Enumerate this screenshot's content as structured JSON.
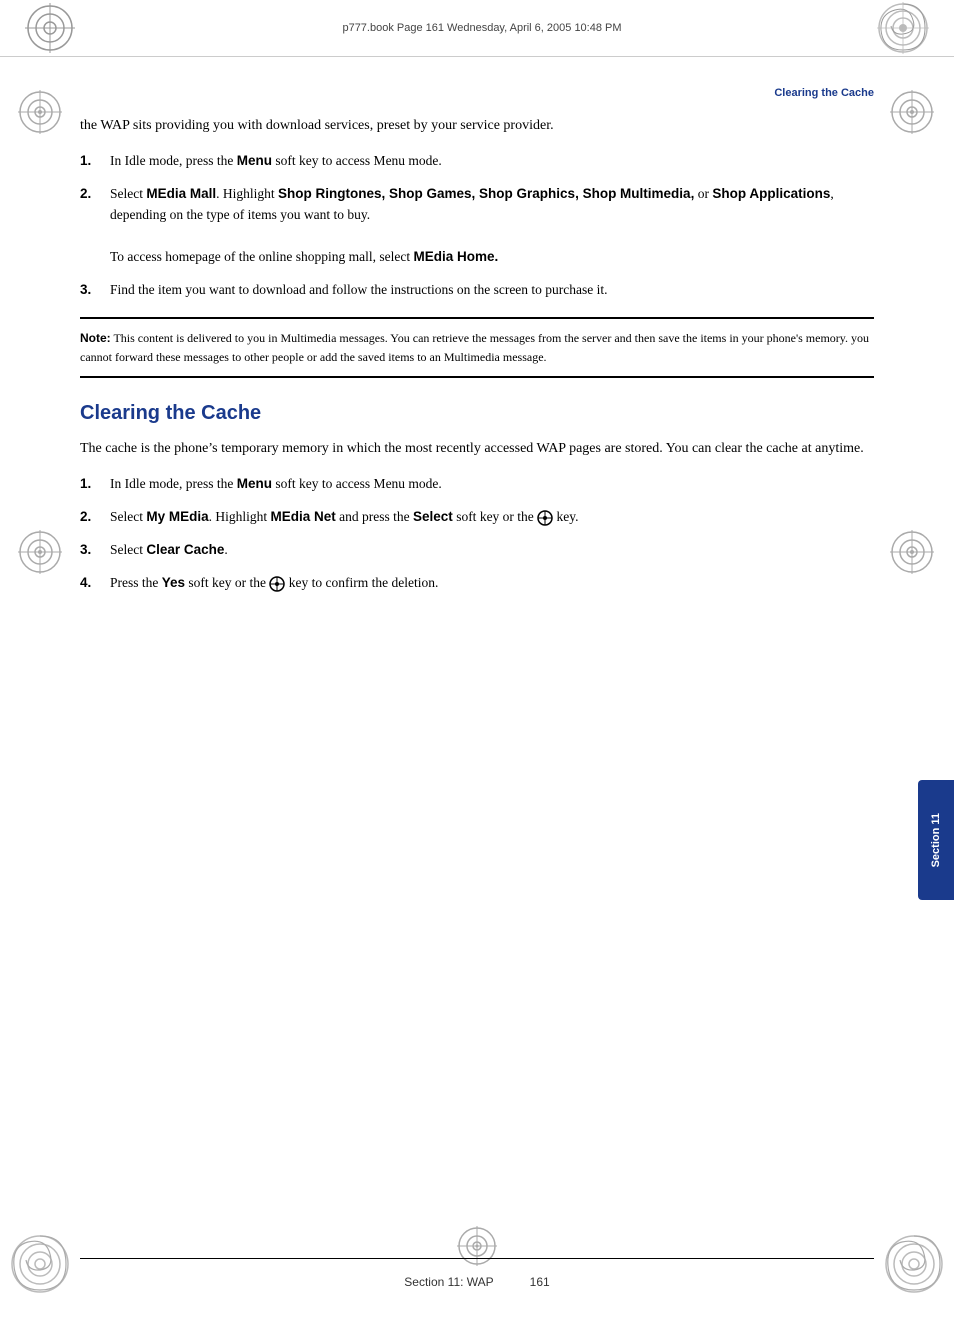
{
  "header": {
    "text": "p777.book  Page 161  Wednesday, April 6, 2005  10:48 PM"
  },
  "section_heading": "Clearing the Cache",
  "intro": "the WAP sits providing you with download services, preset by your service provider.",
  "steps_first": [
    {
      "num": "1.",
      "text_before": "In Idle mode, press the ",
      "bold1": "Menu",
      "text_after": " soft key to access Menu mode."
    },
    {
      "num": "2.",
      "text_before": "Select ",
      "bold1": "MEdia Mall",
      "text_middle1": ". Highlight ",
      "bold2": "Shop Ringtones, Shop Games, Shop Graphics, Shop Multimedia,",
      "text_middle2": " or ",
      "bold3": "Shop Applications",
      "text_end": ", depending on the type of items you want to buy.",
      "extra_line_before": "To access homepage of the online shopping mall, select ",
      "extra_bold": "MEdia Home."
    },
    {
      "num": "3.",
      "text_before": "Find the item you want to download and follow the instructions on the screen to purchase it."
    }
  ],
  "note": {
    "bold_label": "Note:",
    "text": " This content is delivered to you in Multimedia messages. You can retrieve the messages from the server and then save the items in your phone's memory. you cannot forward these messages to other people or add the saved items to an Multimedia message."
  },
  "section_title": "Clearing the Cache",
  "body_text": "The cache is the phone’s temporary memory in which the most recently accessed WAP pages are stored. You can clear the cache at anytime.",
  "steps_second": [
    {
      "num": "1.",
      "text": "In Idle mode, press the ",
      "bold": "Menu",
      "text_after": " soft key to access Menu mode."
    },
    {
      "num": "2.",
      "text": "Select ",
      "bold1": "My MEdia",
      "text_m1": ". Highlight ",
      "bold2": "MEdia Net",
      "text_m2": " and press the ",
      "bold3": "Select",
      "text_m3": " soft key or the ",
      "key_sym": "✕",
      "text_end": " key."
    },
    {
      "num": "3.",
      "text": "Select ",
      "bold": "Clear Cache",
      "text_after": "."
    },
    {
      "num": "4.",
      "text": "Press the ",
      "bold": "Yes",
      "text_m": " soft key or the ",
      "key_sym": "✕",
      "text_end": " key to confirm the deletion."
    }
  ],
  "footer": {
    "label": "Section 11: WAP",
    "page": "161"
  },
  "section_tab": "Section 11"
}
